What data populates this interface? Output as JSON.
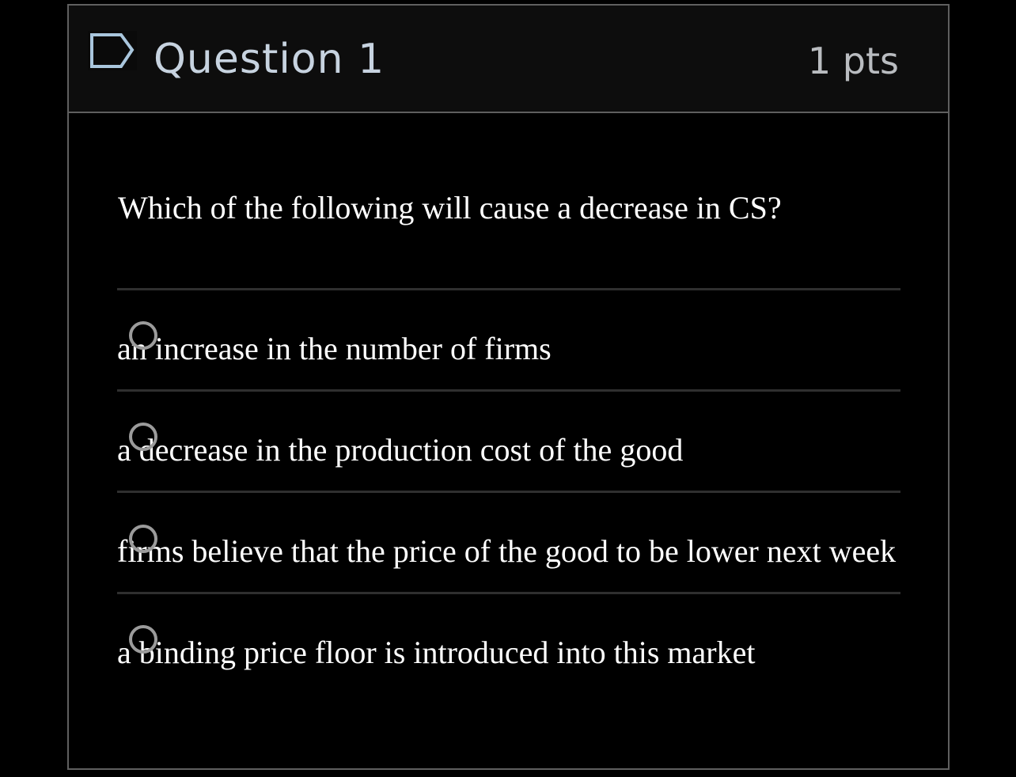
{
  "question": {
    "title": "Question 1",
    "points": "1 pts",
    "flag_icon": "flag-outline-icon",
    "text": "Which of the following will cause a decrease in CS?"
  },
  "answers": [
    {
      "label": "an increase in the number of firms",
      "selected": false
    },
    {
      "label": "a decrease in the production cost of the good",
      "selected": false
    },
    {
      "label": "firms believe that the price of the good to be lower next week",
      "selected": false
    },
    {
      "label": "a binding price floor is introduced into this market",
      "selected": false
    }
  ],
  "colors": {
    "background": "#000000",
    "header_background": "#0d0d0d",
    "border": "#5f5f5f",
    "title_text": "#c7d3e0",
    "points_text": "#b9bcc0",
    "body_text": "#ffffff",
    "radio_border": "#9b9b9b",
    "flag_stroke": "#a9c6dd",
    "divider": "#2f2f2f"
  }
}
